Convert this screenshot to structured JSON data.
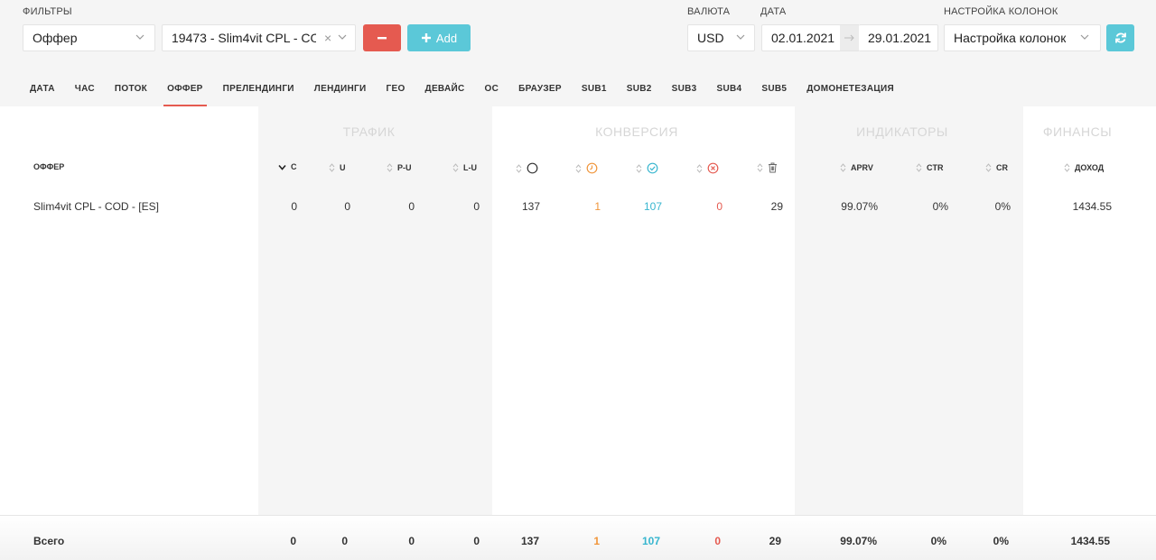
{
  "filters": {
    "label": "ФИЛЬТРЫ",
    "type_value": "Оффер",
    "offer_value": "19473 - Slim4vit CPL - CO...",
    "clear_symbol": "×",
    "add_label": "Add"
  },
  "currency": {
    "label": "ВАЛЮТА",
    "value": "USD"
  },
  "date": {
    "label": "ДАТА",
    "from": "02.01.2021",
    "to": "29.01.2021"
  },
  "columns_setting": {
    "label": "НАСТРОЙКА КОЛОНОК",
    "value": "Настройка колонок"
  },
  "colors": {
    "red": "#e55a50",
    "cyan": "#5bc8d8",
    "orange": "#f0953a",
    "blue": "#38b6cf"
  },
  "tabs": [
    {
      "label": "ДАТА"
    },
    {
      "label": "ЧАС"
    },
    {
      "label": "ПОТОК"
    },
    {
      "label": "ОФФЕР",
      "active": true
    },
    {
      "label": "ПРЕЛЕНДИНГИ"
    },
    {
      "label": "ЛЕНДИНГИ"
    },
    {
      "label": "ГЕО"
    },
    {
      "label": "ДЕВАЙС"
    },
    {
      "label": "ОС"
    },
    {
      "label": "БРАУЗЕР"
    },
    {
      "label": "SUB1"
    },
    {
      "label": "SUB2"
    },
    {
      "label": "SUB3"
    },
    {
      "label": "SUB4"
    },
    {
      "label": "SUB5"
    },
    {
      "label": "ДОМОНЕТЕЗАЦИЯ"
    }
  ],
  "groups": {
    "traffic": "ТРАФИК",
    "conversion": "КОНВЕРСИЯ",
    "indicators": "ИНДИКАТОРЫ",
    "finance": "ФИНАНСЫ"
  },
  "headers": {
    "offer": "ОФФЕР",
    "c": "C",
    "u": "U",
    "pu": "P-U",
    "lu": "L-U",
    "aprv": "APRV",
    "ctr": "CTR",
    "cr": "CR",
    "income": "ДОХОД"
  },
  "header_icons": [
    "circle-icon",
    "clock-icon",
    "check-circle-icon",
    "x-circle-icon",
    "trash-icon"
  ],
  "row": {
    "name": "Slim4vit CPL - COD - [ES]",
    "c": "0",
    "u": "0",
    "pu": "0",
    "lu": "0",
    "total": "137",
    "hold": "1",
    "approved": "107",
    "rejected": "0",
    "trash": "29",
    "aprv": "99.07%",
    "ctr": "0%",
    "cr": "0%",
    "income": "1434.55"
  },
  "totals": {
    "label": "Всего",
    "c": "0",
    "u": "0",
    "pu": "0",
    "lu": "0",
    "total": "137",
    "hold": "1",
    "approved": "107",
    "rejected": "0",
    "trash": "29",
    "aprv": "99.07%",
    "ctr": "0%",
    "cr": "0%",
    "income": "1434.55"
  }
}
